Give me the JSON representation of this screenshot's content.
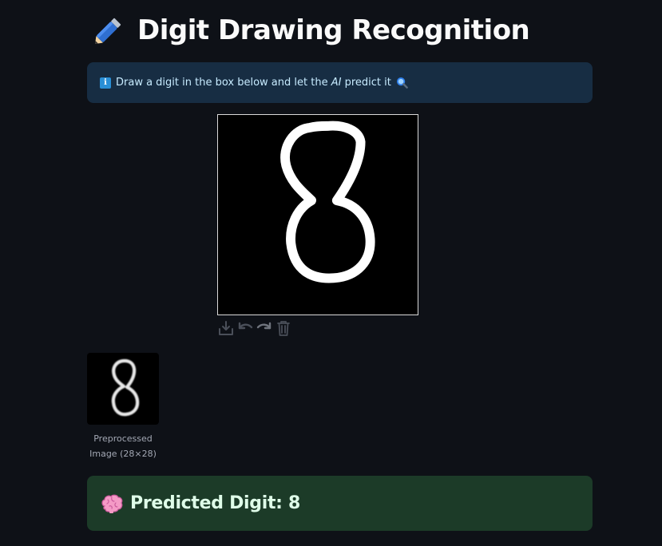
{
  "header": {
    "title": "Digit Drawing Recognition",
    "title_icon": "pencil-icon"
  },
  "info": {
    "icon": "info-icon",
    "icon_glyph": "i",
    "text_before": "Draw a digit in the box below and let the ",
    "text_ai": "AI",
    "text_after": " predict it",
    "trailing_icon": "magnifier-icon"
  },
  "canvas": {
    "background": "#000000",
    "stroke_color": "#ffffff",
    "drawn_digit": "8"
  },
  "toolbar": {
    "items": [
      "download-icon",
      "undo-icon",
      "redo-icon",
      "trash-icon"
    ]
  },
  "preprocessed": {
    "caption_line1": "Preprocessed",
    "caption_line2": "Image (28×28)"
  },
  "prediction": {
    "icon": "brain-icon",
    "label": "Predicted Digit: 8"
  },
  "colors": {
    "page_bg": "#0e1117",
    "info_bg": "#172d43",
    "info_text": "#c7ebff",
    "success_bg": "#1c3b28",
    "success_text": "#dffde9"
  }
}
